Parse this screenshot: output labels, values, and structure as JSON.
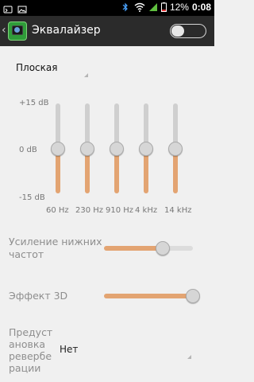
{
  "status_bar": {
    "battery_percent": "12%",
    "clock": "0:08",
    "icons": [
      "android-debug-icon",
      "image-icon",
      "bluetooth-icon",
      "wifi-icon",
      "signal-icon",
      "battery-icon"
    ]
  },
  "action_bar": {
    "title": "Эквалайзер",
    "enabled": false
  },
  "preset": {
    "selected": "Плоская"
  },
  "equalizer": {
    "db_labels": [
      "+15 dB",
      "0 dB",
      "-15 dB"
    ],
    "bands": [
      {
        "freq": "60 Hz",
        "gain_db": 0
      },
      {
        "freq": "230 Hz",
        "gain_db": 0
      },
      {
        "freq": "910 Hz",
        "gain_db": 0
      },
      {
        "freq": "4 kHz",
        "gain_db": 0
      },
      {
        "freq": "14 kHz",
        "gain_db": 0
      }
    ]
  },
  "bass_boost": {
    "label": "Усиление нижних частот",
    "level": 0.66
  },
  "effect_3d": {
    "label": "Эффект 3D",
    "level": 1.0
  },
  "reverb": {
    "label": "Предуст ановка ревербе рации",
    "value": "Нет"
  },
  "colors": {
    "accent": "#e3a472",
    "action_bar": "#2b2b2b",
    "background": "#f0f0f0"
  }
}
